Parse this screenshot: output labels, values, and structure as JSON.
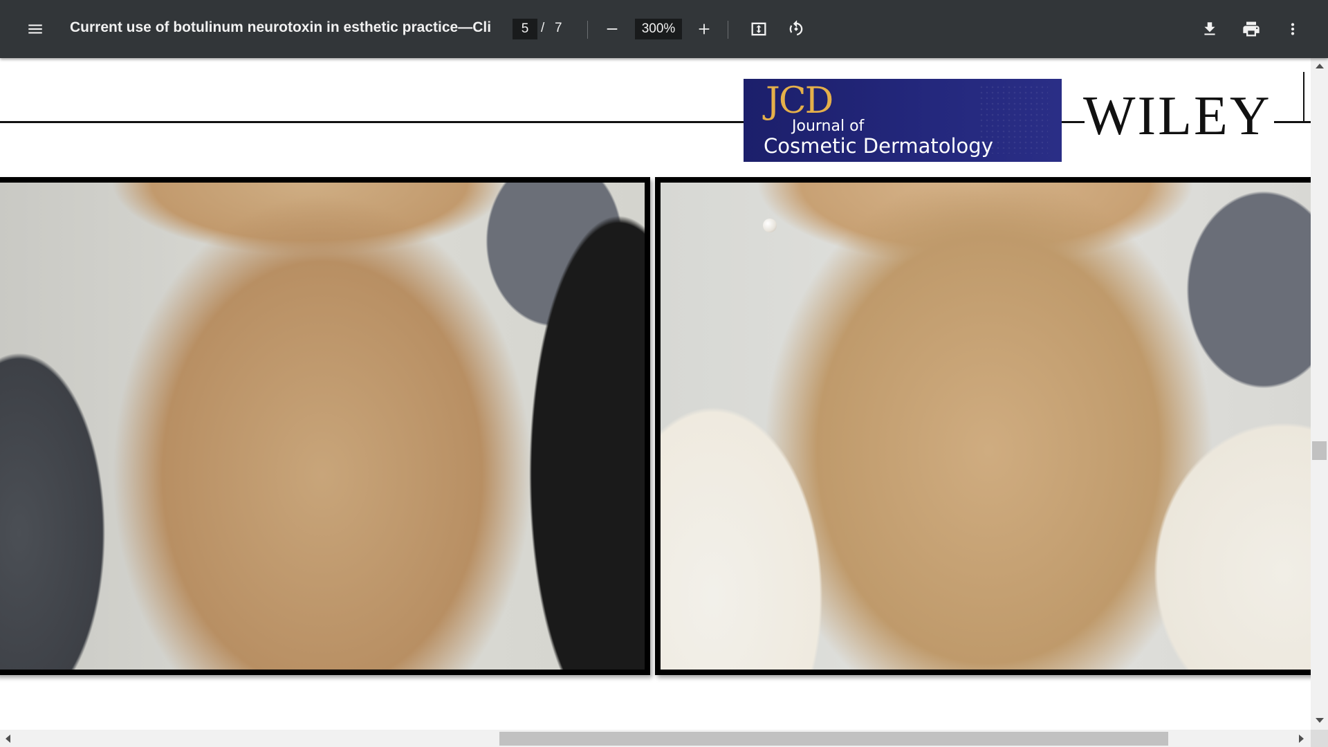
{
  "toolbar": {
    "menu_icon": "menu-icon",
    "title": "Current use of botulinum neurotoxin in esthetic practice—Clinic...",
    "page_current": "5",
    "page_separator": "/",
    "page_total": "7",
    "zoom_out_icon": "minus-icon",
    "zoom_value": "300%",
    "zoom_in_icon": "plus-icon",
    "fit_icon": "fit-to-page-icon",
    "rotate_icon": "rotate-counterclockwise-icon",
    "download_icon": "download-icon",
    "print_icon": "print-icon",
    "more_icon": "more-vert-icon"
  },
  "header": {
    "journal_abbr": "JCD",
    "journal_line1": "Journal of",
    "journal_line2": "Cosmetic Dermatology",
    "publisher": "WILEY"
  },
  "colors": {
    "toolbar_bg": "#323639",
    "journal_logo_bg": "#24287d",
    "journal_abbr": "#e5b04a"
  }
}
